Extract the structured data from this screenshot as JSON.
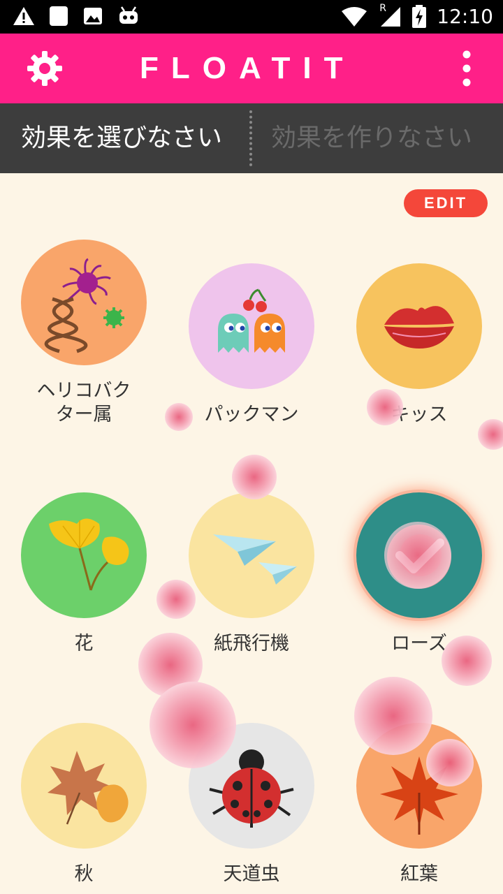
{
  "status_bar": {
    "time": "12:10",
    "left_icons": [
      "warning-icon",
      "sd-card-icon",
      "image-icon",
      "android-icon"
    ],
    "right_icons": [
      "wifi-icon",
      "cell-signal-icon",
      "battery-charging-icon"
    ],
    "roaming_label": "R"
  },
  "app_bar": {
    "title": "FLOATIT",
    "color": "#FF2088",
    "left_icon": "gear-icon",
    "right_icon": "overflow-menu-icon"
  },
  "tabs": {
    "choose_effect": "効果を選びなさい",
    "create_effect": "効果を作りなさい",
    "active": "choose_effect"
  },
  "edit_button": {
    "label": "EDIT",
    "color": "#F4473A"
  },
  "effects": [
    {
      "label": "ヘリコバク\nター属",
      "icon": "bacteria-icon",
      "bg": "#F9A56A"
    },
    {
      "label": "パックマン",
      "icon": "pacman-ghosts-icon",
      "bg": "#EFC4EC"
    },
    {
      "label": "キッス",
      "icon": "kiss-lips-icon",
      "bg": "#F7C35E"
    },
    {
      "label": "花",
      "icon": "ginkgo-leaf-icon",
      "bg": "#6CD06A"
    },
    {
      "label": "紙飛行機",
      "icon": "paper-plane-icon",
      "bg": "#FAE4A0"
    },
    {
      "label": "ローズ",
      "icon": "checkmark-icon",
      "bg": "#2E8E88",
      "selected": true
    },
    {
      "label": "秋",
      "icon": "autumn-leaves-icon",
      "bg": "#FAE4A0"
    },
    {
      "label": "天道虫",
      "icon": "ladybug-icon",
      "bg": "#E6E6E6"
    },
    {
      "label": "紅葉",
      "icon": "maple-leaf-icon",
      "bg": "#F9A56A"
    }
  ]
}
